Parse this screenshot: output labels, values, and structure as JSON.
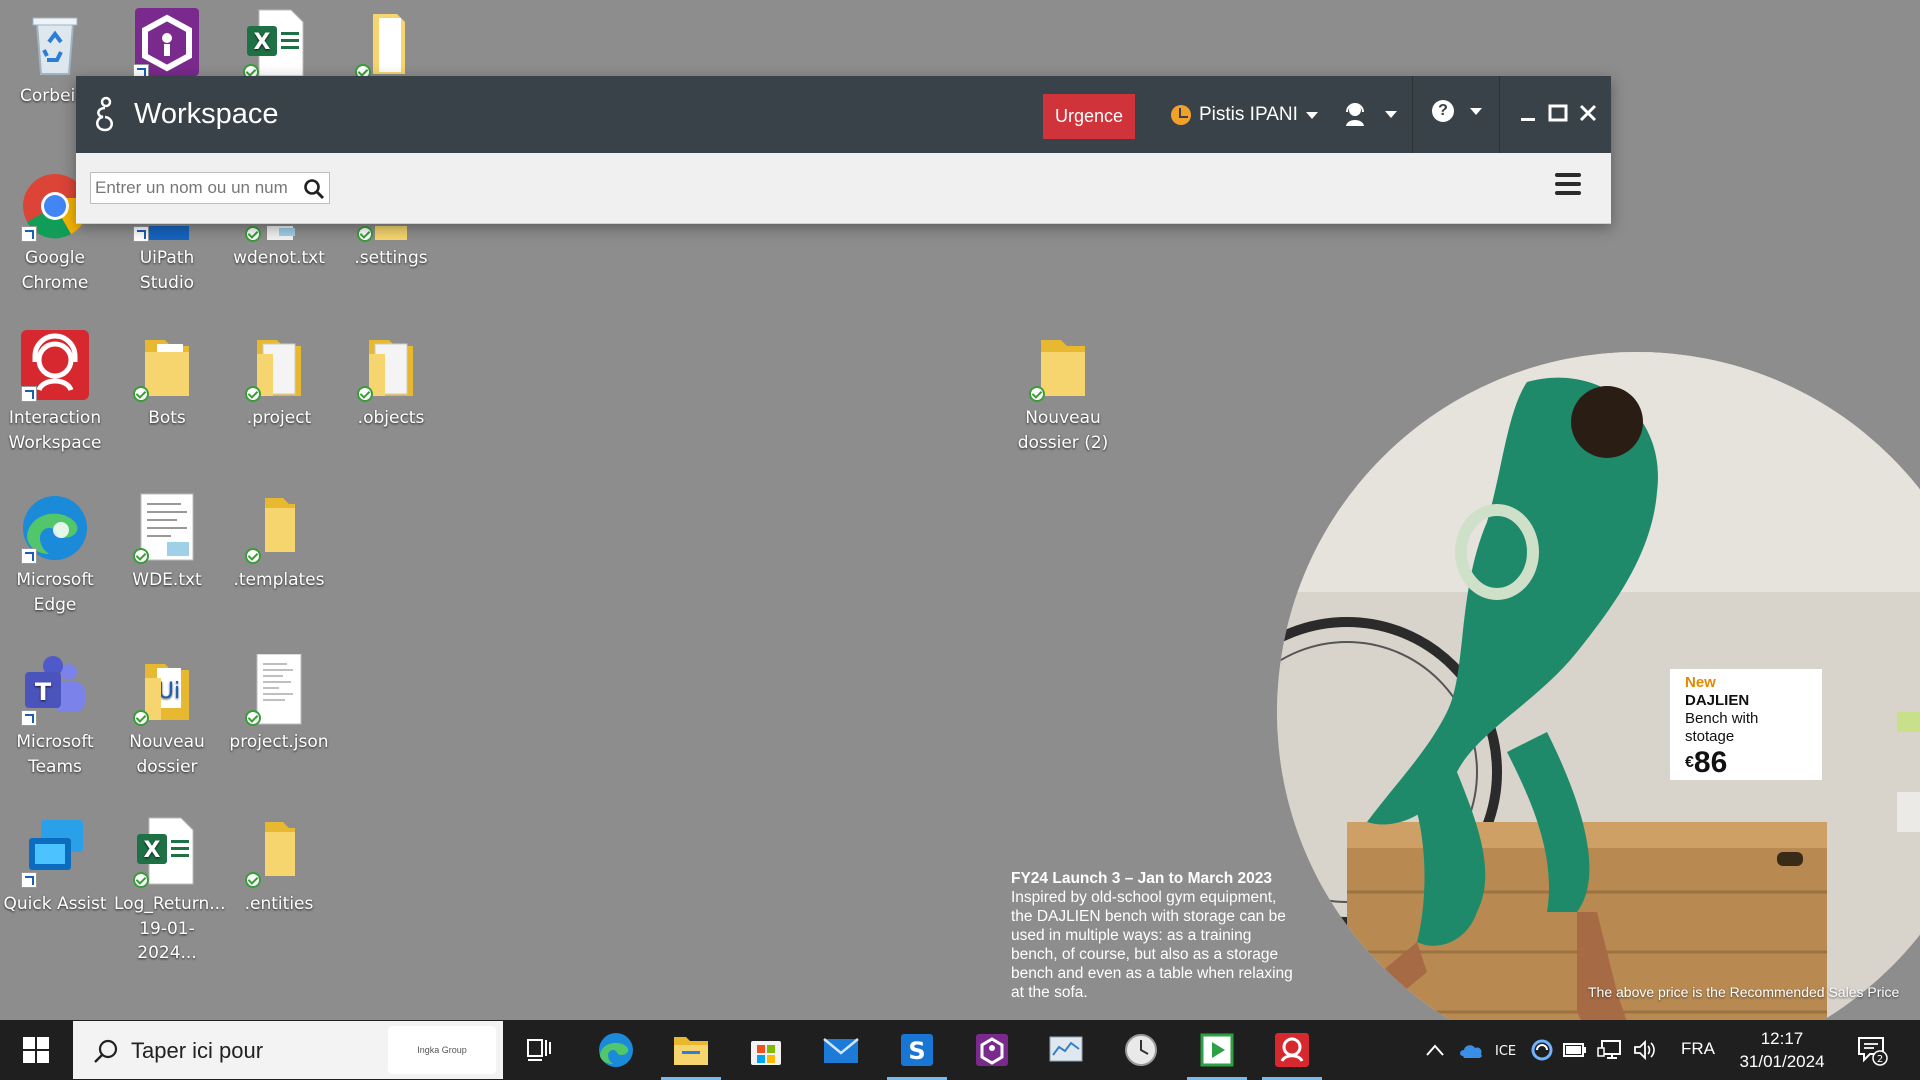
{
  "desktop": {
    "icons": [
      {
        "key": "recycle",
        "label": "Corbeil"
      },
      {
        "key": "uipath-assistant",
        "label": ""
      },
      {
        "key": "excel-top",
        "label": ""
      },
      {
        "key": "file-top",
        "label": ""
      },
      {
        "key": "chrome",
        "label": "Google Chrome"
      },
      {
        "key": "uipath-studio",
        "label": "UiPath Studio"
      },
      {
        "key": "wdenot",
        "label": "wdenot.txt"
      },
      {
        "key": "settings",
        "label": ".settings"
      },
      {
        "key": "interaction-workspace",
        "label": "Interaction Workspace"
      },
      {
        "key": "bots",
        "label": "Bots"
      },
      {
        "key": "project",
        "label": ".project"
      },
      {
        "key": "objects",
        "label": ".objects"
      },
      {
        "key": "nouveau-dossier-2",
        "label": "Nouveau dossier (2)"
      },
      {
        "key": "edge",
        "label": "Microsoft Edge"
      },
      {
        "key": "wde",
        "label": "WDE.txt"
      },
      {
        "key": "templates",
        "label": ".templates"
      },
      {
        "key": "teams",
        "label": "Microsoft Teams"
      },
      {
        "key": "nouveau-dossier",
        "label": "Nouveau dossier"
      },
      {
        "key": "project-json",
        "label": "project.json"
      },
      {
        "key": "quick-assist",
        "label": "Quick Assist"
      },
      {
        "key": "log-return",
        "label": "Log_Return... 19-01-2024..."
      },
      {
        "key": "entities",
        "label": ".entities"
      }
    ]
  },
  "workspace": {
    "title": "Workspace",
    "urgence_label": "Urgence",
    "user_name": "Pistis IPANI",
    "search_placeholder": "Entrer un nom ou un num"
  },
  "wallpaper": {
    "caption_title": "FY24 Launch 3 – Jan to March 2023",
    "caption_body": "Inspired by old-school gym equipment, the DAJLIEN bench with storage can be used in multiple ways: as a training bench, of course, but also as a storage bench and even as a table when relaxing at the sofa.",
    "tag_new": "New",
    "tag_name": "DAJLIEN",
    "tag_desc": "Bench with stotage",
    "tag_currency": "€",
    "tag_price": "86",
    "disclaimer": "The above price is the Recommended Sales Price"
  },
  "taskbar": {
    "search_text": "Taper ici pour",
    "search_thumb": "Ingka Group",
    "language": "FRA",
    "time": "12:17",
    "date": "31/01/2024",
    "notification_count": "2"
  },
  "colors": {
    "titlebar": "#384248",
    "urgence": "#d0333a",
    "desktop": "#8d8d8d",
    "taskbar": "#1f1f1f"
  }
}
